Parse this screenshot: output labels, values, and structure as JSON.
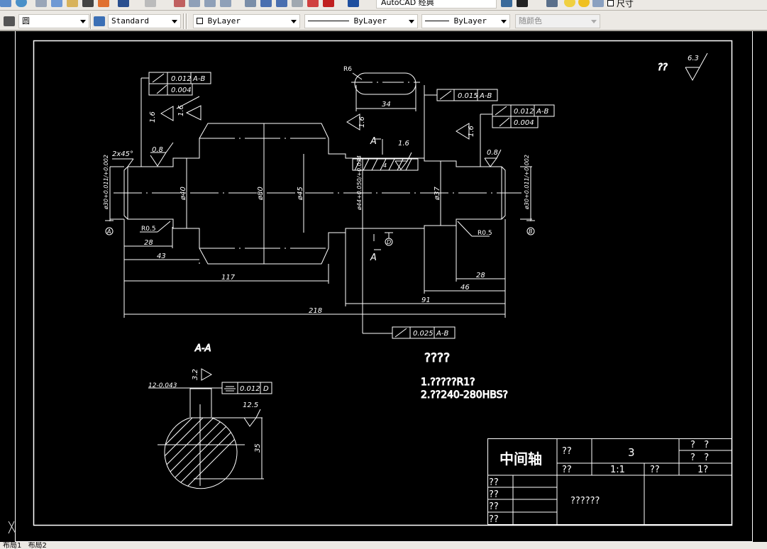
{
  "toolbar_top": {
    "workspace": "AutoCAD 经典",
    "layer_label": "尺寸"
  },
  "toolbar": {
    "text_style": "圆",
    "dim_style": "Standard",
    "color": "ByLayer",
    "linetype": "ByLayer",
    "lineweight": "ByLayer",
    "plot_style": "随颜色"
  },
  "layout_tabs": [
    "布局1",
    "布局2"
  ],
  "drawing": {
    "roughness_general": {
      "label": "??",
      "value": "6.3"
    },
    "tolerances": [
      {
        "symbol": "circular-runout",
        "value": "0.012",
        "datum": "A-B"
      },
      {
        "symbol": "cylindricity",
        "value": "0.004"
      },
      {
        "symbol": "circular-runout",
        "value": "0.015",
        "datum": "A-B"
      },
      {
        "symbol": "circular-runout",
        "value": "0.012",
        "datum": "A-B"
      },
      {
        "symbol": "cylindricity",
        "value": "0.004"
      },
      {
        "symbol": "circular-runout",
        "value": "0.025",
        "datum": "A-B"
      },
      {
        "symbol": "symmetry",
        "value": "0.012",
        "datum": "D"
      }
    ],
    "roughness": [
      "1.6",
      "1.6",
      "1.6",
      "1.6",
      "1.6",
      "0.8",
      "0.8",
      "1.6",
      "3.2",
      "12.5"
    ],
    "dims": {
      "chamfer": "2x45°",
      "d_left": "ø30+0.011/+0.002",
      "d40": "ø40",
      "d80": "ø80",
      "d45": "ø45",
      "d44": "ø44+0.050/+0.034",
      "d37": "ø37",
      "d_right": "ø30+0.011/+0.002",
      "r_left": "R0.5",
      "r_right": "R0.5",
      "r6": "R6",
      "key_len": "34",
      "key_depth": "4",
      "l28a": "28",
      "l43": "43",
      "l117": "117",
      "l218": "218",
      "l91": "91",
      "l46": "46",
      "l28b": "28",
      "key_width": "12-0.043",
      "sec_depth": "35"
    },
    "datums": [
      "A",
      "B",
      "D"
    ],
    "section_marks": [
      "A",
      "A"
    ],
    "section_title": "A-A",
    "notes": {
      "title": "????",
      "lines": [
        "1.?????R1?",
        "2.??240-280HBS?"
      ]
    },
    "title_block": {
      "part_name": "中间轴",
      "c1": "??",
      "qty": "3",
      "r1": "?   ?",
      "r2": "?   ?",
      "c2": "??",
      "scale": "1:1",
      "c3": "??",
      "sheet": "1?",
      "rows": [
        "??",
        "??",
        "??",
        "??"
      ],
      "material": "??????"
    }
  }
}
